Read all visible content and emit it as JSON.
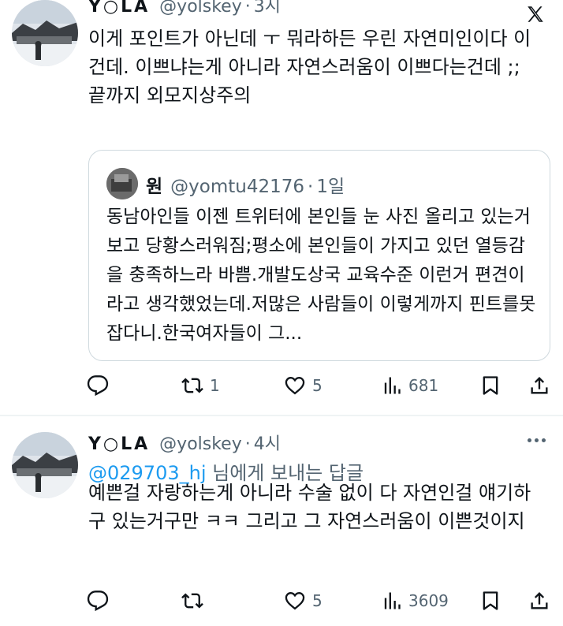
{
  "tweets": [
    {
      "name": "Y○LA",
      "handle": "@yolskey",
      "time": "3시",
      "body": "이게 포인트가 아닌데 ㅜ 뭐라하든 우린 자연미인이다 이건데. 이쁘냐는게 아니라 자연스러움이 이쁘다는건데 ;;\n끝까지 외모지상주의",
      "quote": {
        "name": "원",
        "handle": "@yomtu42176",
        "time": "1일",
        "text": "동남아인들 이젠 트위터에 본인들 눈 사진 올리고 있는거 보고 당황스러워짐;평소에 본인들이 가지고 있던 열등감을 충족하느라 바쁨.개발도상국 교육수준 이런거 편견이라고 생각했었는데.저많은 사람들이 이렇게까지 핀트를못잡다니.한국여자들이 그..."
      },
      "actions": {
        "replies": "",
        "retweets": "1",
        "likes": "5",
        "views": "681"
      }
    },
    {
      "name": "Y○LA",
      "handle": "@yolskey",
      "time": "4시",
      "reply_to": "@029703_hj",
      "reply_suffix": " 님에게 보내는 답글",
      "body": "예쁜걸 자랑하는게 아니라 수술 없이 다 자연인걸 얘기하구 있는거구만 ㅋㅋ 그리고 그 자연스러움이 이쁜것이지",
      "actions": {
        "replies": "",
        "retweets": "",
        "likes": "5",
        "views": "3609"
      }
    }
  ],
  "colors": {
    "text": "#0f1419",
    "secondary": "#536471",
    "link": "#1d9bf0",
    "border": "#cfd9de"
  },
  "icons": [
    "x-logo-icon",
    "more-icon",
    "reply-icon",
    "retweet-icon",
    "like-icon",
    "views-icon",
    "bookmark-icon",
    "share-icon"
  ]
}
